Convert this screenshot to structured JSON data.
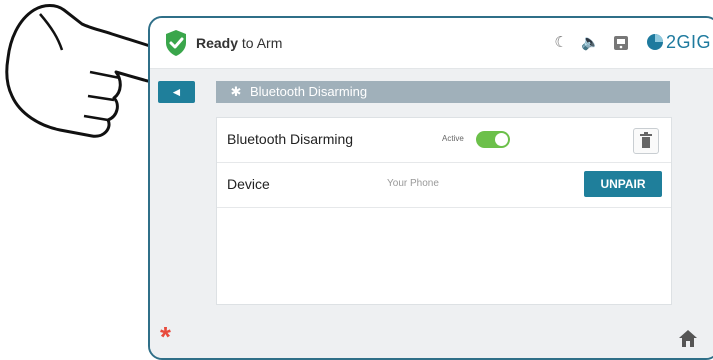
{
  "status": {
    "state_bold": "Ready",
    "state_rest": " to Arm",
    "brand": "2GIG",
    "icons": [
      "moon-icon",
      "volume-icon",
      "panel-icon"
    ]
  },
  "header": {
    "back_icon": "◄",
    "bluetooth_icon": "✱",
    "title": "Bluetooth Disarming"
  },
  "rows": [
    {
      "label": "Bluetooth Disarming",
      "status_text": "Active",
      "toggle_on": true
    },
    {
      "label": "Device",
      "value": "Your Phone",
      "button": "UNPAIR"
    }
  ],
  "footer": {
    "asterisk": "*"
  },
  "colors": {
    "accent": "#1f7f9b",
    "toggle": "#6cc04a",
    "alert": "#e84a3c",
    "shield": "#3aa64b"
  }
}
